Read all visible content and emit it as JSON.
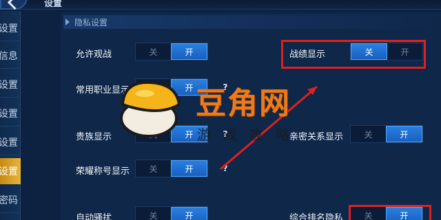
{
  "header": {
    "title": "设置"
  },
  "sidebar": {
    "items": [
      {
        "label": "设置",
        "active": false
      },
      {
        "label": "信息",
        "active": false
      },
      {
        "label": "设置",
        "active": false
      },
      {
        "label": "设置",
        "active": false
      },
      {
        "label": "设置",
        "active": false
      },
      {
        "label": "设置",
        "active": true
      },
      {
        "label": "密码",
        "active": false
      }
    ]
  },
  "section": {
    "title": "隐私设置"
  },
  "settings": [
    {
      "label": "允许观战",
      "off": "关",
      "on": "开",
      "selected": "on"
    },
    {
      "label": "战绩显示",
      "off": "关",
      "on": "开",
      "selected": "off"
    },
    {
      "label": "常用职业显示",
      "off": "关",
      "on": "开",
      "selected": "on"
    },
    {
      "label": "贵族显示",
      "off": "关",
      "on": "开",
      "selected": "on"
    },
    {
      "label": "亲密关系显示",
      "off": "关",
      "on": "开",
      "selected": "on"
    },
    {
      "label": "荣耀称号显示",
      "off": "关",
      "on": "开",
      "selected": "on"
    },
    {
      "label": "自动骚扰",
      "off": "关",
      "on": "开",
      "selected": "on"
    },
    {
      "label": "综合排名隐私",
      "off": "关",
      "on": "开",
      "selected": "on"
    }
  ],
  "help_glyph": "?",
  "watermark": {
    "title": "豆角网",
    "subtitle": "游戏攻略"
  },
  "colors": {
    "highlight": "#e02020",
    "toggle_on": "#2a7fe0",
    "active_tab": "#e9b43a",
    "background": "#0d2140"
  },
  "icons": {
    "back": "back-arrow-icon",
    "help": "question-icon",
    "section": "triangle-right-icon"
  }
}
